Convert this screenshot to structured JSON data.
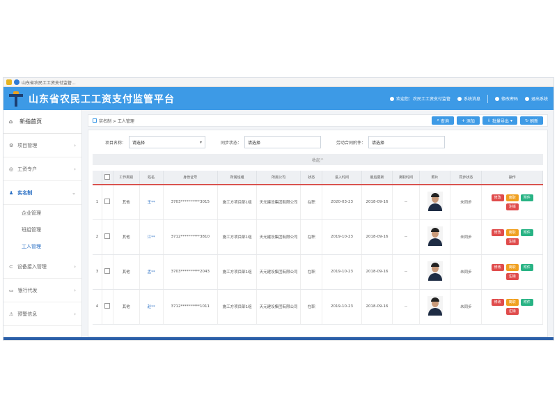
{
  "window": {
    "tab_title": "山东省农民工工资支付监管..."
  },
  "header": {
    "title": "山东省农民工工资支付监管平台",
    "links": [
      "欢迎您：农民工工资支付监管",
      "系统消息",
      "修改密码",
      "退出系统"
    ]
  },
  "sidebar": {
    "home": "新指首页",
    "items": [
      {
        "label": "项目管理",
        "icon": "project-icon",
        "active": false
      },
      {
        "label": "工资专户",
        "icon": "account-icon",
        "active": false
      },
      {
        "label": "实名制",
        "icon": "user-icon",
        "active": true,
        "subitems": [
          "企业管理",
          "班组管理",
          "工人管理"
        ]
      },
      {
        "label": "设备接入管理",
        "icon": "device-icon",
        "active": false
      },
      {
        "label": "银行代发",
        "icon": "bank-icon",
        "active": false
      },
      {
        "label": "预警信息",
        "icon": "warning-icon",
        "active": false
      }
    ]
  },
  "breadcrumb": "实名制 > 工人管理",
  "toolbar": {
    "buttons": [
      "查询",
      "添加",
      "批量导出",
      "刷新"
    ]
  },
  "filters": [
    {
      "label": "项目名称：",
      "value": "请选择",
      "select": true
    },
    {
      "label": "同步状态：",
      "value": "请选择",
      "select": false
    },
    {
      "label": "劳动合同附件：",
      "value": "请选择",
      "select": false
    }
  ],
  "collapse_label": "收起^",
  "table": {
    "headers": [
      "",
      "",
      "工作类别",
      "姓名",
      "身份证号",
      "所属班组",
      "所属公司",
      "状态",
      "进入时间",
      "最后更新",
      "离职时间",
      "照片",
      "同步状态",
      "操作"
    ],
    "rows": [
      {
        "no": "1",
        "type": "其他",
        "name": "王**",
        "id": "3703**********3015",
        "team": "施工方项目部1组",
        "company": "天元建设集团有限公司",
        "status": "在职",
        "in": "2020-03-23",
        "updated": "2018-09-16",
        "left": "--",
        "sync": "未同步"
      },
      {
        "no": "2",
        "type": "其他",
        "name": "江**",
        "id": "3712**********3810",
        "team": "施工方项目部1组",
        "company": "天元建设集团有限公司",
        "status": "在职",
        "in": "2019-10-23",
        "updated": "2018-09-16",
        "left": "--",
        "sync": "未同步"
      },
      {
        "no": "3",
        "type": "其他",
        "name": "孟**",
        "id": "3703**********2043",
        "team": "施工方项目部1组",
        "company": "天元建设集团有限公司",
        "status": "在职",
        "in": "2019-10-23",
        "updated": "2018-09-16",
        "left": "--",
        "sync": "未同步"
      },
      {
        "no": "4",
        "type": "其他",
        "name": "赵**",
        "id": "3712**********1011",
        "team": "施工方项目部1组",
        "company": "天元建设集团有限公司",
        "status": "在职",
        "in": "2019-10-23",
        "updated": "2018-09-16",
        "left": "--",
        "sync": "未同步"
      }
    ],
    "op_buttons": [
      "修改",
      "离职",
      "附件",
      "注销"
    ]
  },
  "colors": {
    "header": "#3d9ae6",
    "accent": "#2a6fc4",
    "red": "#e04c4c",
    "orange": "#f0a020",
    "green": "#28b384"
  }
}
